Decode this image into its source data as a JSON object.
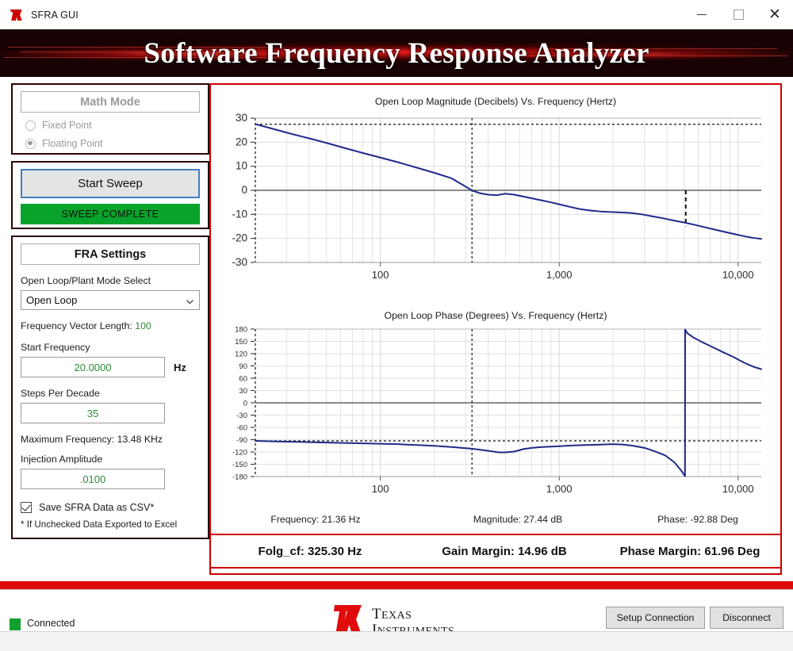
{
  "window": {
    "title": "SFRA GUI",
    "app_icon": "ti-logo-icon",
    "minimize_label": "–",
    "maximize_label": "□",
    "close_label": "✕"
  },
  "banner": {
    "title": "Software Frequency Response Analyzer"
  },
  "math_mode": {
    "header": "Math Mode",
    "options": [
      {
        "label": "Fixed Point",
        "selected": false
      },
      {
        "label": "Floating Point",
        "selected": true
      }
    ]
  },
  "sweep": {
    "start_button": "Start Sweep",
    "status": "SWEEP COMPLETE",
    "status_color": "#07a32a"
  },
  "fra_settings": {
    "header": "FRA Settings",
    "mode_select_label": "Open Loop/Plant Mode Select",
    "mode_select_value": "Open Loop",
    "mode_select_options": [
      "Open Loop",
      "Plant"
    ],
    "frequency_vector_label": "Frequency Vector Length:",
    "frequency_vector_value": "100",
    "start_frequency_label": "Start Frequency",
    "start_frequency_value": "20.0000",
    "start_frequency_unit": "Hz",
    "steps_per_decade_label": "Steps Per Decade",
    "steps_per_decade_value": "35",
    "maximum_frequency_label": "Maximum Frequency:",
    "maximum_frequency_value": "13.48 KHz",
    "injection_amplitude_label": "Injection Amplitude",
    "injection_amplitude_value": ".0100",
    "save_csv_label": "Save SFRA Data as CSV*",
    "save_csv_checked": true,
    "csv_footnote": "* If Unchecked Data Exported to Excel"
  },
  "cursor_readout": {
    "frequency": "Frequency: 21.36 Hz",
    "magnitude": "Magnitude: 27.44 dB",
    "phase": "Phase: -92.88 Deg"
  },
  "results": {
    "folg_cf": "Folg_cf: 325.30 Hz",
    "gain_margin": "Gain Margin: 14.96 dB",
    "phase_margin": "Phase Margin: 61.96 Deg"
  },
  "footer": {
    "connection_status": "Connected",
    "connection_color": "#11a02b",
    "logo_line1": "T",
    "logo_line1_rest": "EXAS",
    "logo_line2": "I",
    "logo_line2_rest": "NSTRUMENTS",
    "setup_connection_button": "Setup Connection",
    "disconnect_button": "Disconnect"
  },
  "chart_data": [
    {
      "type": "line",
      "id": "magnitude",
      "title": "Open Loop Magnitude (Decibels) Vs. Frequency (Hertz)",
      "xlabel": "",
      "ylabel": "",
      "xscale": "log",
      "xlim": [
        20,
        13480
      ],
      "ylim": [
        -30,
        30
      ],
      "yticks": [
        30,
        20,
        10,
        0,
        -10,
        -20,
        -30
      ],
      "xticks": [
        100,
        1000,
        10000
      ],
      "xticklabels": [
        "100",
        "1,000",
        "10,000"
      ],
      "grid": true,
      "series": [
        {
          "name": "Open Loop Magnitude",
          "color": "#1f2a8a",
          "x": [
            20,
            25,
            32,
            40,
            50,
            63,
            80,
            100,
            125,
            160,
            200,
            250,
            325,
            360,
            400,
            450,
            500,
            560,
            630,
            700,
            800,
            900,
            1000,
            1150,
            1300,
            1500,
            1700,
            1900,
            2200,
            2500,
            2900,
            3300,
            3800,
            4400,
            5000,
            5600,
            6300,
            7200,
            8200,
            9400,
            10800,
            12200,
            13480
          ],
          "y": [
            27.5,
            25.6,
            23.4,
            21.6,
            19.7,
            17.6,
            15.5,
            13.6,
            11.7,
            9.4,
            7.3,
            5.0,
            0.0,
            -1.2,
            -1.8,
            -2.0,
            -1.4,
            -1.8,
            -2.6,
            -3.3,
            -4.2,
            -5.0,
            -5.8,
            -6.9,
            -7.8,
            -8.4,
            -8.8,
            -9.0,
            -9.2,
            -9.4,
            -10.0,
            -10.8,
            -11.6,
            -12.6,
            -13.4,
            -14.2,
            -15.1,
            -16.1,
            -17.1,
            -18.1,
            -19.1,
            -19.8,
            -20.2
          ]
        }
      ],
      "cursor_lines": [
        {
          "orientation": "vertical",
          "x": 20,
          "style": "dashed",
          "color": "#111111"
        },
        {
          "orientation": "vertical",
          "x": 325.3,
          "style": "dashed",
          "color": "#111111"
        },
        {
          "orientation": "horizontal",
          "y": 27.44,
          "style": "dashed",
          "color": "#111111"
        },
        {
          "orientation": "horizontal",
          "y": 0,
          "style": "solid",
          "color": "#444444"
        }
      ],
      "gain_margin_marker": {
        "x": 5100,
        "y_from": 0,
        "y_to": -14.96,
        "style": "dashed",
        "color": "#111111"
      }
    },
    {
      "type": "line",
      "id": "phase",
      "title": "Open Loop Phase (Degrees) Vs. Frequency (Hertz)",
      "xlabel": "",
      "ylabel": "",
      "xscale": "log",
      "xlim": [
        20,
        13480
      ],
      "ylim": [
        -180,
        180
      ],
      "yticks": [
        180,
        150,
        120,
        90,
        60,
        30,
        0,
        -30,
        -60,
        -90,
        -120,
        -150,
        -180
      ],
      "xticks": [
        100,
        1000,
        10000
      ],
      "xticklabels": [
        "100",
        "1,000",
        "10,000"
      ],
      "grid": true,
      "series": [
        {
          "name": "Open Loop Phase",
          "color": "#1f2a8a",
          "x": [
            20,
            25,
            32,
            40,
            50,
            63,
            80,
            100,
            125,
            160,
            200,
            250,
            325,
            400,
            460,
            500,
            560,
            630,
            700,
            800,
            900,
            1000,
            1200,
            1400,
            1700,
            2000,
            2300,
            2600,
            3000,
            3400,
            3900,
            4400,
            4800,
            5050,
            5060,
            5200,
            5600,
            6300,
            7200,
            8200,
            9400,
            10800,
            12200,
            13480
          ],
          "y": [
            -93,
            -94,
            -95,
            -96,
            -97,
            -98,
            -99,
            -100,
            -101,
            -103,
            -105,
            -108,
            -112,
            -117,
            -121,
            -121,
            -119,
            -113,
            -110,
            -108,
            -107,
            -106,
            -104,
            -103,
            -102,
            -101,
            -102,
            -105,
            -110,
            -118,
            -128,
            -145,
            -165,
            -179,
            179,
            170,
            160,
            148,
            136,
            124,
            112,
            98,
            88,
            82
          ]
        }
      ],
      "cursor_lines": [
        {
          "orientation": "vertical",
          "x": 20,
          "style": "dashed",
          "color": "#111111"
        },
        {
          "orientation": "vertical",
          "x": 325.3,
          "style": "dashed",
          "color": "#111111"
        },
        {
          "orientation": "horizontal",
          "y": -92.88,
          "style": "dashed",
          "color": "#111111"
        },
        {
          "orientation": "horizontal",
          "y": 0,
          "style": "solid",
          "color": "#444444"
        }
      ]
    }
  ]
}
